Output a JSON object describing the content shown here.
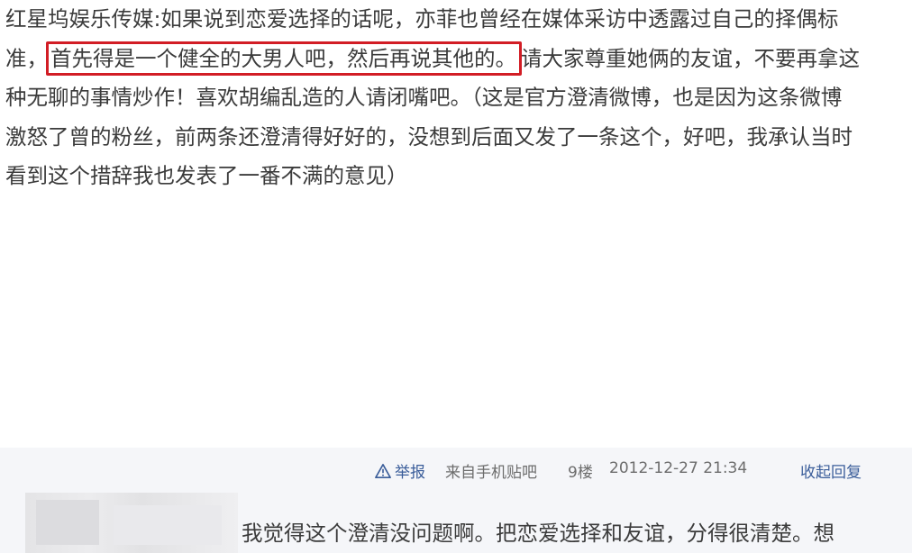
{
  "post": {
    "line1": "红星坞娱乐传媒:如果说到恋爱选择的话呢，亦菲也曾经在媒体采访中透露过自己的择偶标",
    "line2_before": "准，",
    "line2_highlight": "首先得是一个健全的大男人吧，然后再说其他的。",
    "line2_after": "请大家尊重她俩的友谊，不要再拿这",
    "line3": "种无聊的事情炒作！喜欢胡编乱造的人请闭嘴吧。（这是官方澄清微博，也是因为这条微博",
    "line4": "激怒了曾的粉丝，前两条还澄清得好好的，没想到后面又发了一条这个，好吧，我承认当时",
    "line5": "看到这个措辞我也发表了一番不满的意见）"
  },
  "meta": {
    "report_label": "举报",
    "source_label": "来自手机贴吧",
    "floor_label": "9楼",
    "timestamp": "2012-12-27 21:34",
    "collapse_label": "收起回复",
    "link_color": "#3a5d9a",
    "highlight_color": "#d21d25"
  },
  "reply": {
    "text": "我觉得这个澄清没问题啊。把恋爱选择和友谊，分得很清楚。想"
  }
}
